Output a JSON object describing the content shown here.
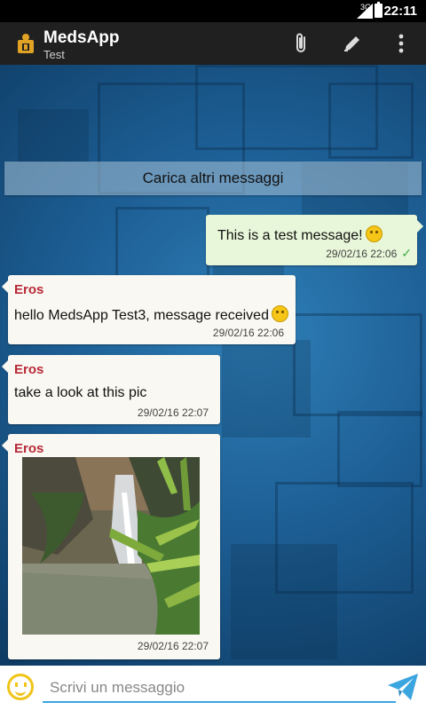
{
  "status_bar": {
    "network": "3G",
    "time": "22:11"
  },
  "app_bar": {
    "title": "MedsApp",
    "subtitle": "Test",
    "actions": [
      "paperclip-icon",
      "pencil-icon",
      "overflow-menu-icon"
    ]
  },
  "chat": {
    "load_more_label": "Carica altri messaggi",
    "messages": [
      {
        "direction": "out",
        "text": "This is a test message!",
        "emoji": "smiley",
        "timestamp": "29/02/16 22:06",
        "delivered": true
      },
      {
        "direction": "in",
        "sender": "Eros",
        "text": "hello MedsApp Test3, message received",
        "emoji": "wink",
        "timestamp": "29/02/16 22:06"
      },
      {
        "direction": "in",
        "sender": "Eros",
        "text": "take a look at this pic",
        "timestamp": "29/02/16 22:07"
      },
      {
        "direction": "in",
        "sender": "Eros",
        "type": "image",
        "image_subject": "waterfall with plants",
        "timestamp": "29/02/16 22:07"
      }
    ]
  },
  "composer": {
    "placeholder": "Scrivi un messaggio",
    "value": ""
  },
  "colors": {
    "sender_name": "#b82a3a",
    "outgoing_bubble": "#e8f7d9",
    "incoming_bubble": "#faf8f2",
    "accent": "#3aa5df",
    "delivered_check": "#3fae4c"
  }
}
